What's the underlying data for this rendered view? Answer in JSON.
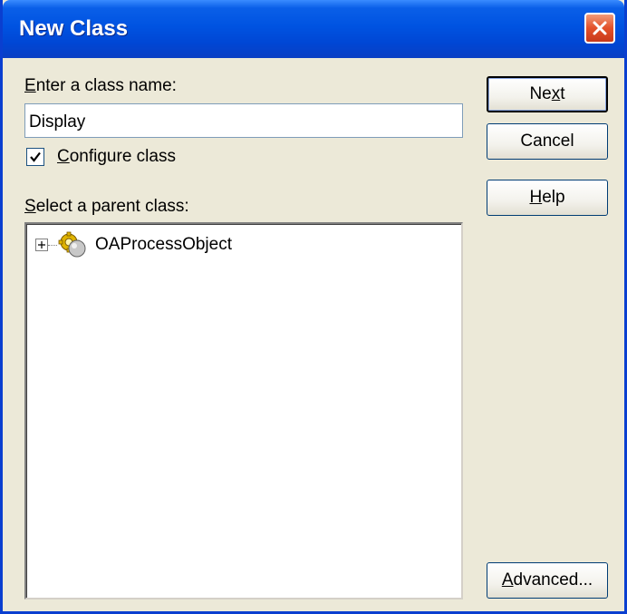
{
  "window": {
    "title": "New Class"
  },
  "form": {
    "class_name_label": "Enter a class name:",
    "class_name_value": "Display",
    "configure_label": "Configure class",
    "configure_checked": true,
    "parent_label": "Select a parent class:"
  },
  "tree": {
    "nodes": [
      {
        "label": "OAProcessObject",
        "expanded": false
      }
    ]
  },
  "buttons": {
    "next": "Next",
    "cancel": "Cancel",
    "help": "Help",
    "advanced": "Advanced..."
  }
}
